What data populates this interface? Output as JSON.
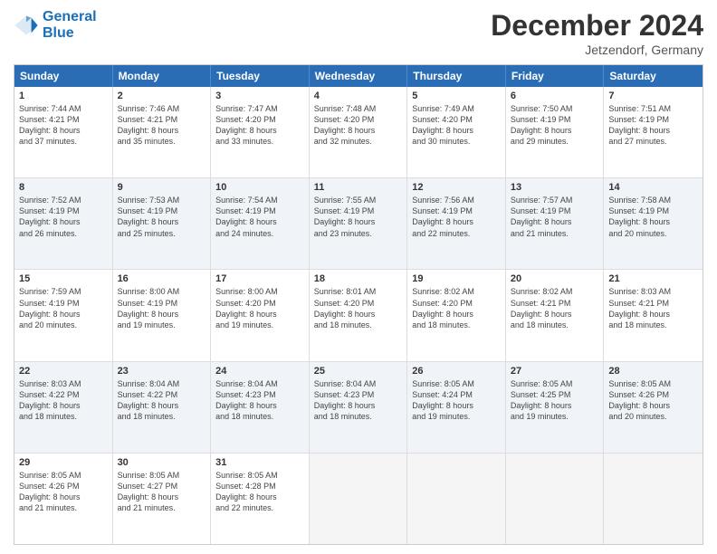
{
  "logo": {
    "line1": "General",
    "line2": "Blue"
  },
  "title": "December 2024",
  "location": "Jetzendorf, Germany",
  "header_days": [
    "Sunday",
    "Monday",
    "Tuesday",
    "Wednesday",
    "Thursday",
    "Friday",
    "Saturday"
  ],
  "weeks": [
    [
      {
        "day": "1",
        "lines": [
          "Sunrise: 7:44 AM",
          "Sunset: 4:21 PM",
          "Daylight: 8 hours",
          "and 37 minutes."
        ]
      },
      {
        "day": "2",
        "lines": [
          "Sunrise: 7:46 AM",
          "Sunset: 4:21 PM",
          "Daylight: 8 hours",
          "and 35 minutes."
        ]
      },
      {
        "day": "3",
        "lines": [
          "Sunrise: 7:47 AM",
          "Sunset: 4:20 PM",
          "Daylight: 8 hours",
          "and 33 minutes."
        ]
      },
      {
        "day": "4",
        "lines": [
          "Sunrise: 7:48 AM",
          "Sunset: 4:20 PM",
          "Daylight: 8 hours",
          "and 32 minutes."
        ]
      },
      {
        "day": "5",
        "lines": [
          "Sunrise: 7:49 AM",
          "Sunset: 4:20 PM",
          "Daylight: 8 hours",
          "and 30 minutes."
        ]
      },
      {
        "day": "6",
        "lines": [
          "Sunrise: 7:50 AM",
          "Sunset: 4:19 PM",
          "Daylight: 8 hours",
          "and 29 minutes."
        ]
      },
      {
        "day": "7",
        "lines": [
          "Sunrise: 7:51 AM",
          "Sunset: 4:19 PM",
          "Daylight: 8 hours",
          "and 27 minutes."
        ]
      }
    ],
    [
      {
        "day": "8",
        "lines": [
          "Sunrise: 7:52 AM",
          "Sunset: 4:19 PM",
          "Daylight: 8 hours",
          "and 26 minutes."
        ]
      },
      {
        "day": "9",
        "lines": [
          "Sunrise: 7:53 AM",
          "Sunset: 4:19 PM",
          "Daylight: 8 hours",
          "and 25 minutes."
        ]
      },
      {
        "day": "10",
        "lines": [
          "Sunrise: 7:54 AM",
          "Sunset: 4:19 PM",
          "Daylight: 8 hours",
          "and 24 minutes."
        ]
      },
      {
        "day": "11",
        "lines": [
          "Sunrise: 7:55 AM",
          "Sunset: 4:19 PM",
          "Daylight: 8 hours",
          "and 23 minutes."
        ]
      },
      {
        "day": "12",
        "lines": [
          "Sunrise: 7:56 AM",
          "Sunset: 4:19 PM",
          "Daylight: 8 hours",
          "and 22 minutes."
        ]
      },
      {
        "day": "13",
        "lines": [
          "Sunrise: 7:57 AM",
          "Sunset: 4:19 PM",
          "Daylight: 8 hours",
          "and 21 minutes."
        ]
      },
      {
        "day": "14",
        "lines": [
          "Sunrise: 7:58 AM",
          "Sunset: 4:19 PM",
          "Daylight: 8 hours",
          "and 20 minutes."
        ]
      }
    ],
    [
      {
        "day": "15",
        "lines": [
          "Sunrise: 7:59 AM",
          "Sunset: 4:19 PM",
          "Daylight: 8 hours",
          "and 20 minutes."
        ]
      },
      {
        "day": "16",
        "lines": [
          "Sunrise: 8:00 AM",
          "Sunset: 4:19 PM",
          "Daylight: 8 hours",
          "and 19 minutes."
        ]
      },
      {
        "day": "17",
        "lines": [
          "Sunrise: 8:00 AM",
          "Sunset: 4:20 PM",
          "Daylight: 8 hours",
          "and 19 minutes."
        ]
      },
      {
        "day": "18",
        "lines": [
          "Sunrise: 8:01 AM",
          "Sunset: 4:20 PM",
          "Daylight: 8 hours",
          "and 18 minutes."
        ]
      },
      {
        "day": "19",
        "lines": [
          "Sunrise: 8:02 AM",
          "Sunset: 4:20 PM",
          "Daylight: 8 hours",
          "and 18 minutes."
        ]
      },
      {
        "day": "20",
        "lines": [
          "Sunrise: 8:02 AM",
          "Sunset: 4:21 PM",
          "Daylight: 8 hours",
          "and 18 minutes."
        ]
      },
      {
        "day": "21",
        "lines": [
          "Sunrise: 8:03 AM",
          "Sunset: 4:21 PM",
          "Daylight: 8 hours",
          "and 18 minutes."
        ]
      }
    ],
    [
      {
        "day": "22",
        "lines": [
          "Sunrise: 8:03 AM",
          "Sunset: 4:22 PM",
          "Daylight: 8 hours",
          "and 18 minutes."
        ]
      },
      {
        "day": "23",
        "lines": [
          "Sunrise: 8:04 AM",
          "Sunset: 4:22 PM",
          "Daylight: 8 hours",
          "and 18 minutes."
        ]
      },
      {
        "day": "24",
        "lines": [
          "Sunrise: 8:04 AM",
          "Sunset: 4:23 PM",
          "Daylight: 8 hours",
          "and 18 minutes."
        ]
      },
      {
        "day": "25",
        "lines": [
          "Sunrise: 8:04 AM",
          "Sunset: 4:23 PM",
          "Daylight: 8 hours",
          "and 18 minutes."
        ]
      },
      {
        "day": "26",
        "lines": [
          "Sunrise: 8:05 AM",
          "Sunset: 4:24 PM",
          "Daylight: 8 hours",
          "and 19 minutes."
        ]
      },
      {
        "day": "27",
        "lines": [
          "Sunrise: 8:05 AM",
          "Sunset: 4:25 PM",
          "Daylight: 8 hours",
          "and 19 minutes."
        ]
      },
      {
        "day": "28",
        "lines": [
          "Sunrise: 8:05 AM",
          "Sunset: 4:26 PM",
          "Daylight: 8 hours",
          "and 20 minutes."
        ]
      }
    ],
    [
      {
        "day": "29",
        "lines": [
          "Sunrise: 8:05 AM",
          "Sunset: 4:26 PM",
          "Daylight: 8 hours",
          "and 21 minutes."
        ]
      },
      {
        "day": "30",
        "lines": [
          "Sunrise: 8:05 AM",
          "Sunset: 4:27 PM",
          "Daylight: 8 hours",
          "and 21 minutes."
        ]
      },
      {
        "day": "31",
        "lines": [
          "Sunrise: 8:05 AM",
          "Sunset: 4:28 PM",
          "Daylight: 8 hours",
          "and 22 minutes."
        ]
      },
      null,
      null,
      null,
      null
    ]
  ]
}
